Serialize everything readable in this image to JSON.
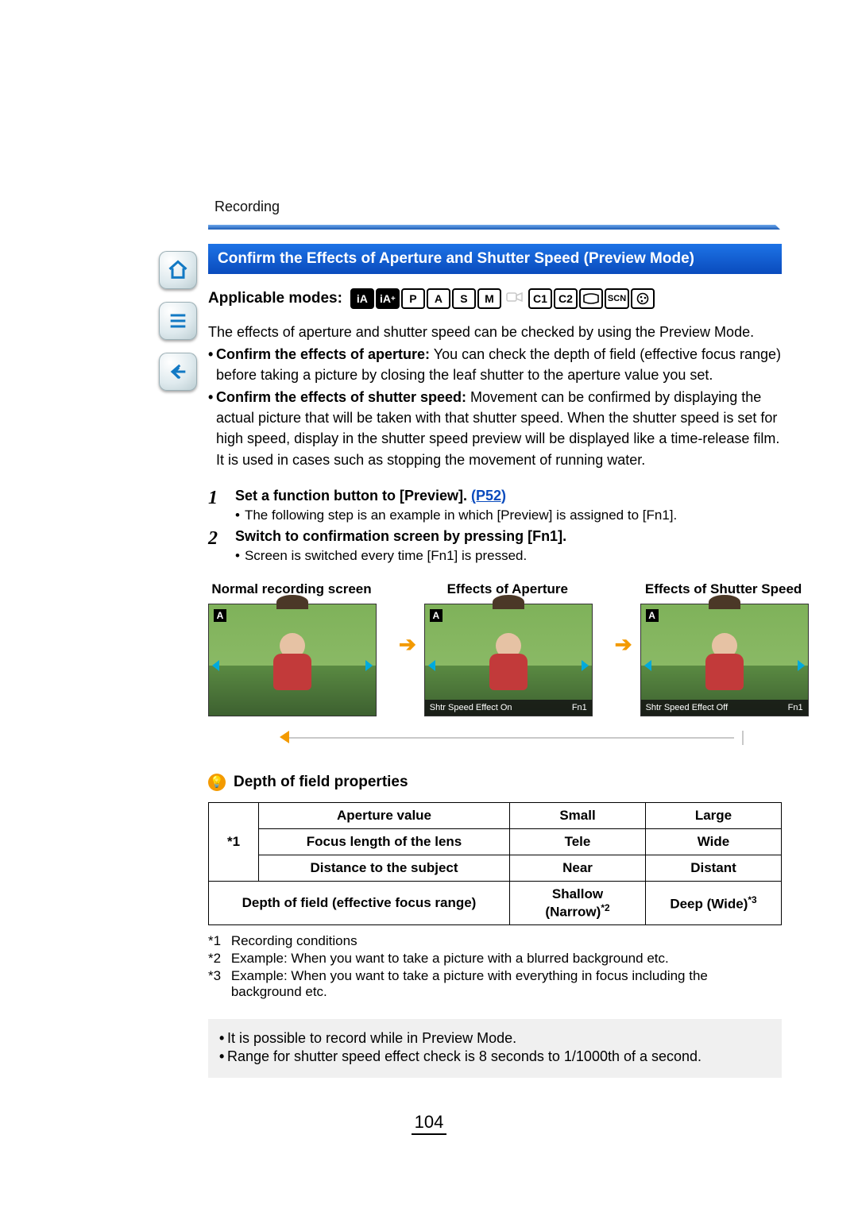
{
  "section": "Recording",
  "heading": "Confirm the Effects of Aperture and Shutter Speed (Preview Mode)",
  "applicable_label": "Applicable modes:",
  "modes": [
    {
      "label": "iA",
      "state": "active",
      "graphic": true
    },
    {
      "label": "iA+",
      "state": "active",
      "graphic": true
    },
    {
      "label": "P",
      "state": "on"
    },
    {
      "label": "A",
      "state": "on"
    },
    {
      "label": "S",
      "state": "on"
    },
    {
      "label": "M",
      "state": "on"
    },
    {
      "label": "MOV",
      "state": "dim",
      "graphic": true
    },
    {
      "label": "C1",
      "state": "on"
    },
    {
      "label": "C2",
      "state": "on"
    },
    {
      "label": "PANO",
      "state": "on",
      "graphic": true
    },
    {
      "label": "SCN",
      "state": "on"
    },
    {
      "label": "ART",
      "state": "on",
      "graphic": true
    }
  ],
  "intro": "The effects of aperture and shutter speed can be checked by using the Preview Mode.",
  "bullets": [
    {
      "bold": "Confirm the effects of aperture:",
      "text": " You can check the depth of field (effective focus range) before taking a picture by closing the leaf shutter to the aperture value you set."
    },
    {
      "bold": "Confirm the effects of shutter speed:",
      "text": " Movement can be confirmed by displaying the actual picture that will be taken with that shutter speed. When the shutter speed is set for high speed, display in the shutter speed preview will be displayed like a time-release film. It is used in cases such as stopping the movement of running water."
    }
  ],
  "steps": [
    {
      "num": "1",
      "title": "Set a function button to [Preview].",
      "link": "(P52)",
      "sub": "The following step is an example in which [Preview] is assigned to [Fn1]."
    },
    {
      "num": "2",
      "title": "Switch to confirmation screen by pressing [Fn1].",
      "sub": "Screen is switched every time [Fn1] is pressed."
    }
  ],
  "screens": [
    {
      "label": "Normal recording screen",
      "overlay_left": "",
      "overlay_right": ""
    },
    {
      "label": "Effects of Aperture",
      "overlay_left": "Shtr Speed Effect On",
      "overlay_right": "Fn1"
    },
    {
      "label": "Effects of Shutter Speed",
      "overlay_left": "Shtr Speed Effect Off",
      "overlay_right": "Fn1"
    }
  ],
  "subheading": "Depth of field properties",
  "table": {
    "star": "*1",
    "rows": [
      {
        "a": "Aperture value",
        "b": "Small",
        "c": "Large"
      },
      {
        "a": "Focus length of the lens",
        "b": "Tele",
        "c": "Wide"
      },
      {
        "a": "Distance to the subject",
        "b": "Near",
        "c": "Distant"
      }
    ],
    "last": {
      "a": "Depth of field (effective focus range)",
      "b": "Shallow (Narrow)",
      "bs": "*2",
      "c": "Deep (Wide)",
      "cs": "*3"
    }
  },
  "footnotes": [
    {
      "n": "*1",
      "t": "Recording conditions"
    },
    {
      "n": "*2",
      "t": "Example: When you want to take a picture with a blurred background etc."
    },
    {
      "n": "*3",
      "t": "Example: When you want to take a picture with everything in focus including the background etc."
    }
  ],
  "bottom": [
    "It is possible to record while in Preview Mode.",
    "Range for shutter speed effect check is 8 seconds to 1/1000th of a second."
  ],
  "page_number": "104",
  "nav": {
    "home": "home-icon",
    "toc": "list-icon",
    "back": "back-icon"
  }
}
